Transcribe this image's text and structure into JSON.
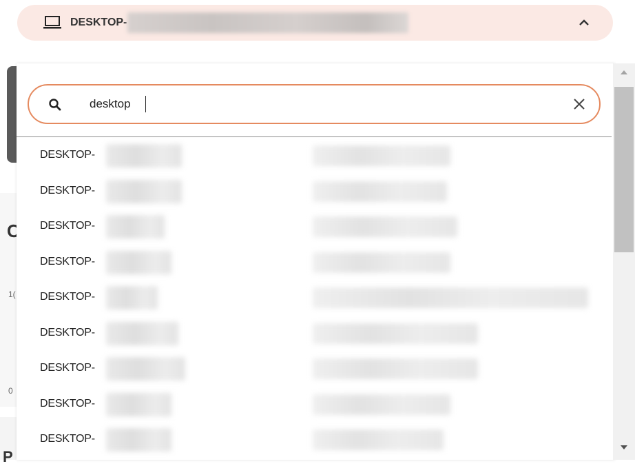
{
  "device_selector": {
    "label": "DESKTOP-",
    "icon": "laptop-icon",
    "expanded_icon": "chevron-up-icon"
  },
  "search": {
    "value": "desktop",
    "placeholder": "",
    "icon": "search-icon",
    "clear_icon": "close-icon"
  },
  "results": [
    {
      "name": "DESKTOP-"
    },
    {
      "name": "DESKTOP-"
    },
    {
      "name": "DESKTOP-"
    },
    {
      "name": "DESKTOP-"
    },
    {
      "name": "DESKTOP-"
    },
    {
      "name": "DESKTOP-"
    },
    {
      "name": "DESKTOP-"
    },
    {
      "name": "DESKTOP-"
    },
    {
      "name": "DESKTOP-"
    }
  ],
  "background": {
    "heading_fragment": "C",
    "number_fragment_1": "1(",
    "number_fragment_2": "0",
    "footer_fragment": "P"
  },
  "colors": {
    "selector_bg": "#fbe9e4",
    "search_border": "#e58a5f"
  }
}
